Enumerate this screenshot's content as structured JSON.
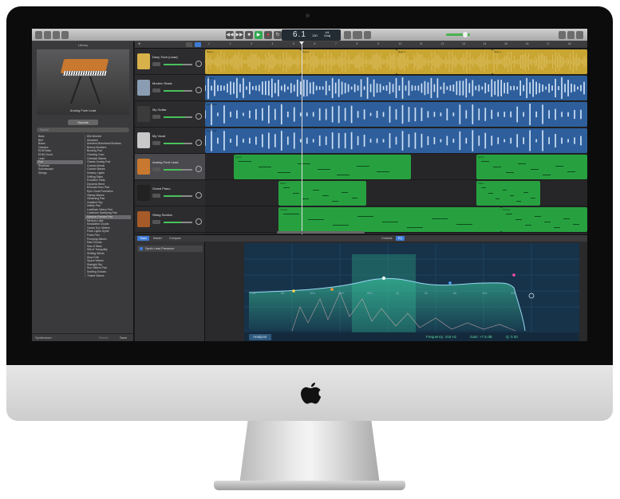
{
  "library": {
    "title": "Library",
    "preview_caption": "Analog Funk Lead",
    "sounds_button": "Sounds",
    "search_placeholder": "Search",
    "categories": [
      "Bass",
      "Bell",
      "Brass",
      "Classics",
      "EDM Bass",
      "EDM Chord",
      "Lead",
      "Pad",
      "Rhythmic",
      "Soundscape",
      "Strings"
    ],
    "selected_category_index": 7,
    "presets": [
      "80s Wonder",
      "Airwaves",
      "Ambient Motorhead Brushes",
      "Breezy Brothers",
      "Buzzing Pad",
      "Chewing Gum",
      "Celestial Waves",
      "Classic Analog Pad",
      "Cosmic Airlock",
      "Cosmic Waves",
      "Dreamy Lights",
      "Drifting Skies",
      "Evolution Pads",
      "Dynamic Bend",
      "Emerald Hour Pad",
      "Epic Cloud Formation",
      "Glassy Waves",
      "Glistening Pad",
      "Gradient Sky",
      "Infinity Pad",
      "Lowflown Heavy Pad",
      "Luminous Sweeping Pad",
      "Massive Fanfare Pad",
      "Mercury Lake",
      "Modulated Clouds",
      "Ocean Sun Glitters",
      "Polar Lights Synth",
      "Pulse Pad",
      "Pumping Waves",
      "Rain Clouds",
      "Sea of Stars",
      "Silk of Tranquility",
      "Shifting Winds",
      "Slow Drift",
      "Space Waves",
      "Starlight Sky",
      "Sun Glitters Pad",
      "Swirling Echoes",
      "Timbre Waves"
    ],
    "selected_preset_index": 22,
    "footer_select": "Synthesizer",
    "revert_label": "Revert",
    "save_label": "Save"
  },
  "lcd": {
    "position": "6.1",
    "tempo": "130",
    "sig_top": "4/4",
    "sig_bottom": "Cmaj"
  },
  "tracks": [
    {
      "name": "Deep Tech (Lead)",
      "type": "audio",
      "color": "#c9a531",
      "fader": 0.68
    },
    {
      "name": "Modern Stack",
      "type": "audio",
      "color": "#2e5f9c",
      "fader": 0.7
    },
    {
      "name": "My Guitar",
      "type": "audio",
      "color": "#2e5f9c",
      "fader": 0.75
    },
    {
      "name": "My Vocal",
      "type": "audio",
      "color": "#2e5f9c",
      "fader": 0.72
    },
    {
      "name": "Analog Funk Lead",
      "type": "midi",
      "color": "#27a140",
      "fader": 0.62
    },
    {
      "name": "Grand Piano",
      "type": "midi",
      "color": "#27a140",
      "fader": 0.6
    },
    {
      "name": "String Section",
      "type": "midi",
      "color": "#27a140",
      "fader": 0.6
    }
  ],
  "selected_track_index": 4,
  "ruler_marks": [
    "1",
    "2",
    "3",
    "4",
    "5",
    "6",
    "7",
    "8",
    "9",
    "10",
    "11",
    "12",
    "13",
    "14",
    "15",
    "16",
    "17",
    "18"
  ],
  "regions": {
    "lane0": [
      {
        "label": "Beat 1"
      },
      {
        "label": "Beat 2"
      },
      {
        "label": "Beat 3"
      },
      {
        "label": "Beat 4"
      }
    ],
    "lane1": [
      {
        "label": "Bass 2"
      }
    ],
    "lane2": [
      {
        "label": "My Guitar"
      }
    ],
    "lane3": [
      {
        "label": "My Vocal"
      }
    ],
    "lane4": [
      {
        "label": "Synth"
      },
      {
        "label": "Synth"
      }
    ],
    "lane5": [
      {
        "label": "Piano"
      },
      {
        "label": "Piano"
      }
    ],
    "lane6": [
      {
        "label": "Strings"
      },
      {
        "label": "Strings"
      }
    ]
  },
  "editor": {
    "tabs": [
      "Track",
      "Master",
      "Compare"
    ],
    "right_tabs": [
      "Controls",
      "EQ"
    ],
    "plugin_name": "Synth Lead Presence",
    "analyzer_label": "Analyzer",
    "frequency_label": "Frequency: 415 Hz",
    "gain_label": "Gain: +7.5 dB",
    "q_label": "Q: 0.30",
    "freq_ticks": [
      "20",
      "50",
      "100",
      "200",
      "500",
      "1k",
      "2k",
      "5k",
      "10k",
      "20k"
    ]
  }
}
